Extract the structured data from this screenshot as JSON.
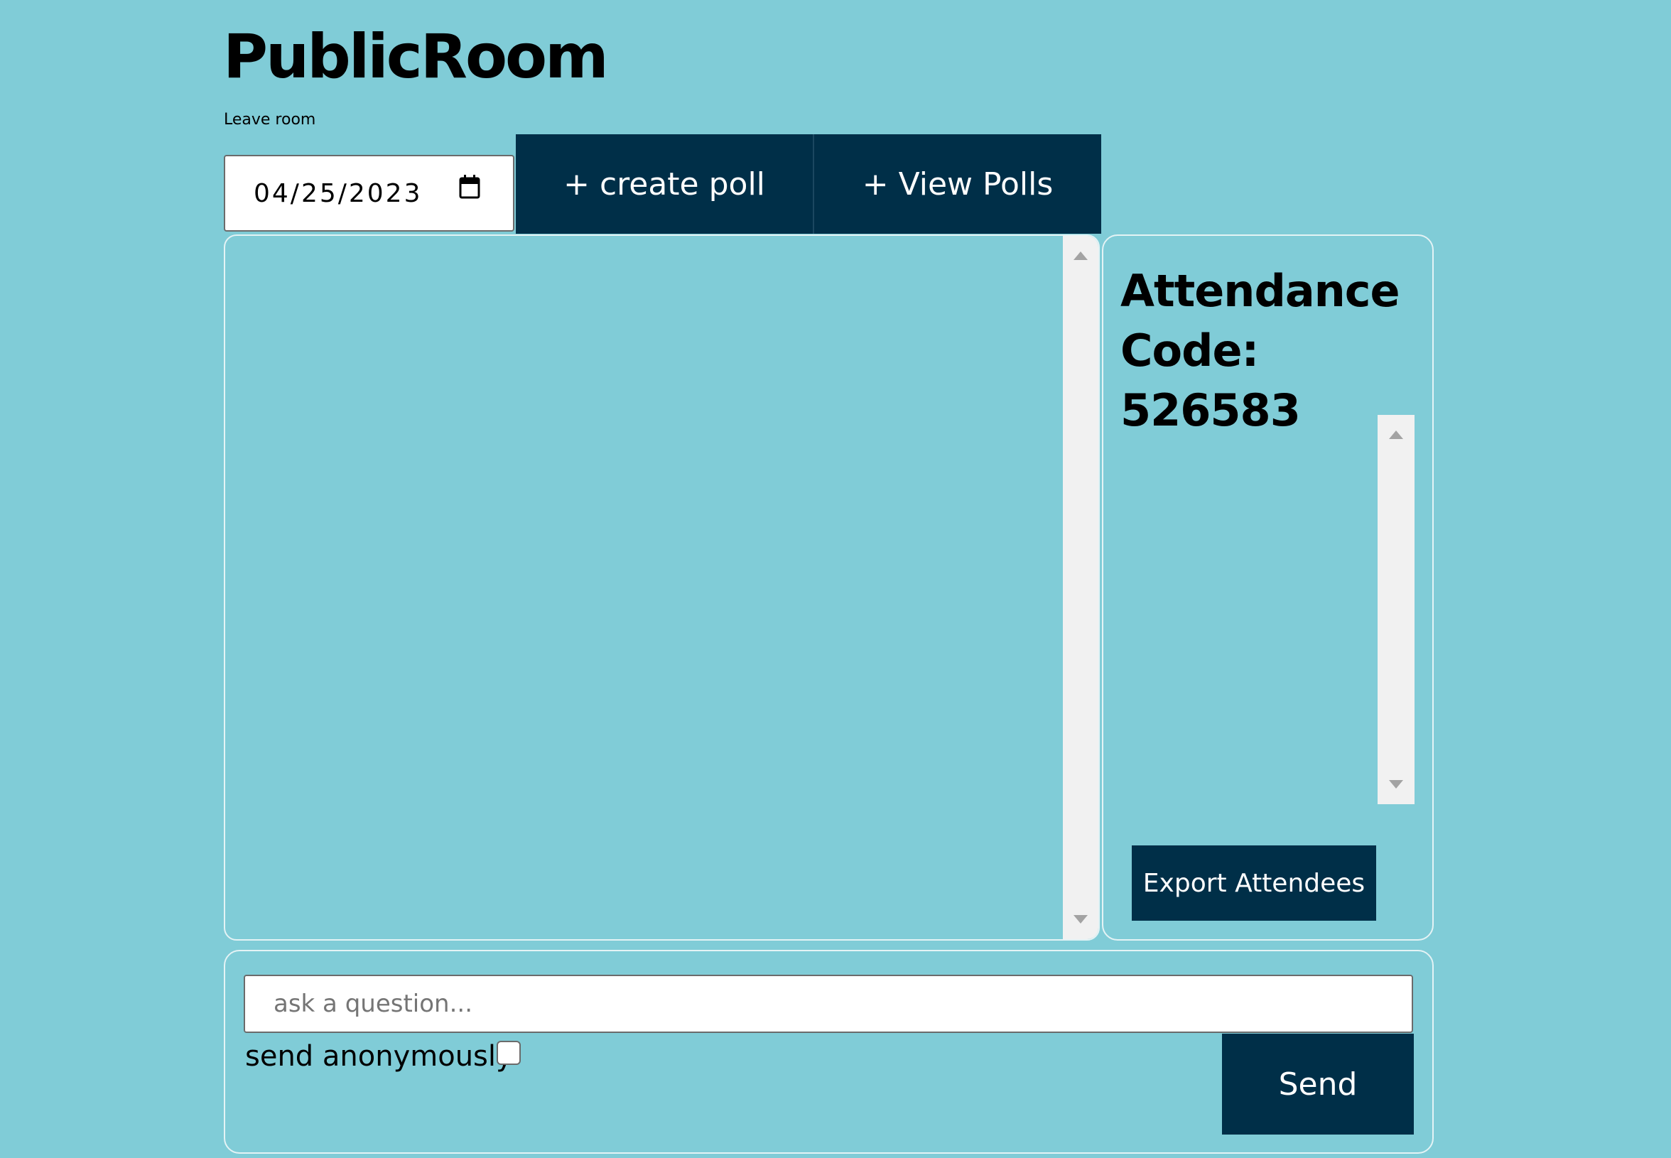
{
  "header": {
    "title": "PublicRoom",
    "leave_link": "Leave room"
  },
  "toolbar": {
    "date_value": "04/25/2023",
    "create_poll_label": "+ create poll",
    "view_polls_label": "+ View Polls"
  },
  "attendance": {
    "code_label": "Attendance Code: 526583",
    "export_label": "Export Attendees"
  },
  "ask": {
    "placeholder": "ask a question...",
    "anonymous_label": "send anonymously",
    "anonymous_checked": false,
    "send_label": "Send"
  },
  "colors": {
    "background": "#80ccd7",
    "button": "#002f48",
    "button_text": "#ffffff"
  }
}
